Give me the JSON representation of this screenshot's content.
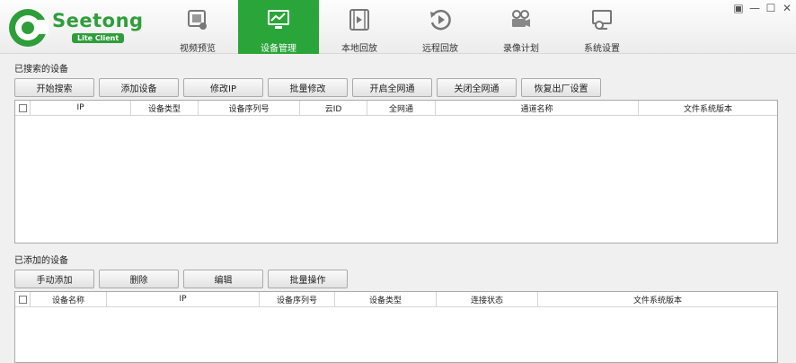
{
  "logo": {
    "word": "Seetong",
    "badge": "Lite Client"
  },
  "nav": [
    {
      "label": "视频预览",
      "icon": "video-preview-icon"
    },
    {
      "label": "设备管理",
      "icon": "device-management-icon",
      "active": true
    },
    {
      "label": "本地回放",
      "icon": "local-playback-icon"
    },
    {
      "label": "远程回放",
      "icon": "remote-playback-icon"
    },
    {
      "label": "录像计划",
      "icon": "record-plan-icon"
    },
    {
      "label": "系统设置",
      "icon": "system-settings-icon"
    }
  ],
  "window_controls": {
    "user": "▣",
    "minimize": "—",
    "maximize": "☐",
    "close": "✕"
  },
  "searched": {
    "title": "已搜索的设备",
    "buttons": [
      "开始搜索",
      "添加设备",
      "修改IP",
      "批量修改",
      "开启全网通",
      "关闭全网通",
      "恢复出厂设置"
    ],
    "columns": [
      "",
      "IP",
      "设备类型",
      "设备序列号",
      "云ID",
      "全网通",
      "通道名称",
      "文件系统版本"
    ]
  },
  "added": {
    "title": "已添加的设备",
    "buttons": [
      "手动添加",
      "删除",
      "编辑",
      "批量操作"
    ],
    "columns": [
      "",
      "设备名称",
      "IP",
      "设备序列号",
      "设备类型",
      "连接状态",
      "文件系统版本"
    ]
  },
  "colors": {
    "accent": "#2aa53a",
    "brand": "#2e9e3a"
  }
}
